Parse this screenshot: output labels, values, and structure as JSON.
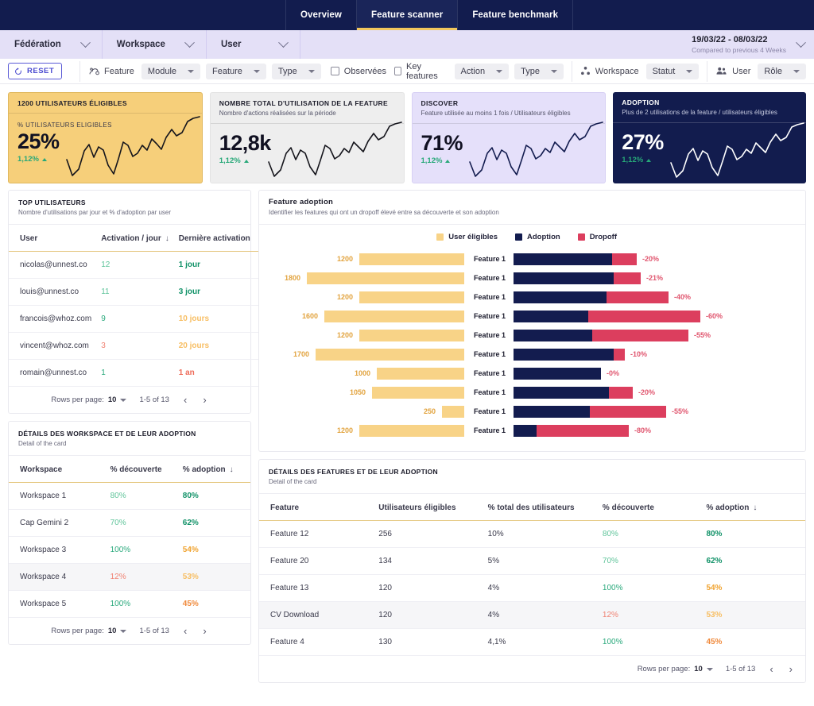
{
  "nav": {
    "tabs": [
      {
        "label": "Overview",
        "active": false
      },
      {
        "label": "Feature scanner",
        "active": true
      },
      {
        "label": "Feature benchmark",
        "active": false
      }
    ]
  },
  "filters_primary": {
    "items": [
      {
        "label": "Fédération"
      },
      {
        "label": "Workspace"
      },
      {
        "label": "User"
      }
    ],
    "date_range": "19/03/22 - 08/03/22",
    "date_compare": "Compared to previous 4 Weeks"
  },
  "filters_secondary": {
    "reset_label": "RESET",
    "feature_group_label": "Feature",
    "feature_pills": [
      "Module",
      "Feature",
      "Type"
    ],
    "checkboxes": [
      "Observées",
      "Key features"
    ],
    "action_pills": [
      "Action",
      "Type"
    ],
    "workspace_group_label": "Workspace",
    "workspace_pill": "Statut",
    "user_group_label": "User",
    "user_pill": "Rôle"
  },
  "kpis": [
    {
      "title_strong": "1200",
      "title_rest": " UTILISATEURS ÉLIGIBLES",
      "subtitle": "",
      "sublabel": "% UTILISATEURS ELIGIBLES",
      "value": "25%",
      "delta": "1,12%",
      "theme": "yellow"
    },
    {
      "title_strong": "",
      "title_rest": "NOMBRE TOTAL D'UTILISATION DE LA FEATURE",
      "subtitle": "Nombre d'actions réalisées sur la période",
      "sublabel": "",
      "value": "12,8k",
      "delta": "1,12%",
      "theme": "grey"
    },
    {
      "title_strong": "",
      "title_rest": "DISCOVER",
      "subtitle": "Feature utilisée au moins 1 fois / Utilisateurs éligibles",
      "sublabel": "",
      "value": "71%",
      "delta": "1,12%",
      "theme": "lavender"
    },
    {
      "title_strong": "",
      "title_rest": "ADOPTION",
      "subtitle": "Plus de 2 utilisations de la feature / utilisateurs éligibles",
      "sublabel": "",
      "value": "27%",
      "delta": "1,12%",
      "theme": "navy"
    }
  ],
  "top_users_card": {
    "title": "TOP UTILISATEURS",
    "subtitle": "Nombre d'utilisations par jour et % d'adoption par user",
    "columns": [
      "User",
      "Activation / jour",
      "Dernière activation"
    ],
    "sort_column": "Activation / jour",
    "rows": [
      {
        "user": "nicolas@unnest.co",
        "activation": "12",
        "activation_color": "green-l",
        "last": "1 jour",
        "last_color": "green-d"
      },
      {
        "user": "louis@unnest.co",
        "activation": "11",
        "activation_color": "green-l",
        "last": "3 jour",
        "last_color": "green-m"
      },
      {
        "user": "francois@whoz.com",
        "activation": "9",
        "activation_color": "green-m",
        "last": "10 jours",
        "last_color": "orange-l"
      },
      {
        "user": "vincent@whoz.com",
        "activation": "3",
        "activation_color": "red-l",
        "last": "20 jours",
        "last_color": "orange-l"
      },
      {
        "user": "romain@unnest.co",
        "activation": "1",
        "activation_color": "green-m",
        "last": "1 an",
        "last_color": "red"
      }
    ],
    "pager": {
      "rows_per_page_label": "Rows per page:",
      "rows_per_page_value": "10",
      "range": "1-5 of 13"
    }
  },
  "workspace_card": {
    "title": "DÉTAILS DES WORKSPACE ET DE LEUR ADOPTION",
    "subtitle": "Detail of the card",
    "columns": [
      "Workspace",
      "% découverte",
      "% adoption"
    ],
    "sort_column": "% adoption",
    "rows": [
      {
        "workspace": "Workspace 1",
        "decouverte": "80%",
        "decouverte_color": "green-l",
        "adoption": "80%",
        "adoption_color": "green-d",
        "highlight": false
      },
      {
        "workspace": "Cap Gemini 2",
        "decouverte": "70%",
        "decouverte_color": "green-l",
        "adoption": "62%",
        "adoption_color": "green-d",
        "highlight": false
      },
      {
        "workspace": "Workspace 3",
        "decouverte": "100%",
        "decouverte_color": "green-m",
        "adoption": "54%",
        "adoption_color": "orange",
        "highlight": false
      },
      {
        "workspace": "Workspace 4",
        "decouverte": "12%",
        "decouverte_color": "red-l",
        "adoption": "53%",
        "adoption_color": "orange-l",
        "highlight": true
      },
      {
        "workspace": "Workspace 5",
        "decouverte": "100%",
        "decouverte_color": "green-m",
        "adoption": "45%",
        "adoption_color": "orange-d",
        "highlight": false
      }
    ],
    "pager": {
      "rows_per_page_label": "Rows per page:",
      "rows_per_page_value": "10",
      "range": "1-5 of 13"
    }
  },
  "features_card": {
    "title": "DÉTAILS DES FEATURES ET DE LEUR ADOPTION",
    "subtitle": "Detail of the card",
    "columns": [
      "Feature",
      "Utilisateurs éligibles",
      "% total des utilisateurs",
      "% découverte",
      "% adoption"
    ],
    "sort_column": "% adoption",
    "rows": [
      {
        "feature": "Feature 12",
        "eligibles": "256",
        "pct_total": "10%",
        "decouverte": "80%",
        "decouverte_color": "green-l",
        "adoption": "80%",
        "adoption_color": "green-d",
        "highlight": false
      },
      {
        "feature": "Feature 20",
        "eligibles": "134",
        "pct_total": "5%",
        "decouverte": "70%",
        "decouverte_color": "green-l",
        "adoption": "62%",
        "adoption_color": "green-d",
        "highlight": false
      },
      {
        "feature": "Feature 13",
        "eligibles": "120",
        "pct_total": "4%",
        "decouverte": "100%",
        "decouverte_color": "green-m",
        "adoption": "54%",
        "adoption_color": "orange",
        "highlight": false
      },
      {
        "feature": "CV Download",
        "eligibles": "120",
        "pct_total": "4%",
        "decouverte": "12%",
        "decouverte_color": "red-l",
        "adoption": "53%",
        "adoption_color": "orange-l",
        "highlight": true
      },
      {
        "feature": "Feature 4",
        "eligibles": "130",
        "pct_total": "4,1%",
        "decouverte": "100%",
        "decouverte_color": "green-m",
        "adoption": "45%",
        "adoption_color": "orange-d",
        "highlight": false
      }
    ],
    "pager": {
      "rows_per_page_label": "Rows per page:",
      "rows_per_page_value": "10",
      "range": "1-5 of 13"
    }
  },
  "chart_card": {
    "title": "Feature adoption",
    "subtitle": "Identifier les features qui ont un dropoff élevé entre sa découverte et son adoption"
  },
  "chart_data": {
    "type": "bar",
    "title": "Feature adoption",
    "subtitle": "Identifier les features qui ont un dropoff élevé entre sa découverte et son adoption",
    "orientation": "horizontal",
    "legend": [
      {
        "name": "User éligibles",
        "color": "#F8D387"
      },
      {
        "name": "Adoption",
        "color": "#131C4F"
      },
      {
        "name": "Dropoff",
        "color": "#DC3E5E"
      }
    ],
    "legend_position": "top",
    "grid": false,
    "categories": [
      "Feature 1",
      "Feature 1",
      "Feature 1",
      "Feature 1",
      "Feature 1",
      "Feature 1",
      "Feature 1",
      "Feature 1",
      "Feature 1",
      "Feature 1"
    ],
    "series": [
      {
        "name": "User éligibles",
        "values": [
          1200,
          1800,
          1200,
          1600,
          1200,
          1700,
          1000,
          1050,
          250,
          1200
        ],
        "labels": [
          "1200",
          "1800",
          "1200",
          "1600",
          "1200",
          "1700",
          "1000",
          "1050",
          "250",
          "1200"
        ],
        "max": 1800,
        "align": "right"
      },
      {
        "name": "Adoption",
        "values": [
          80,
          79,
          60,
          40,
          45,
          90,
          100,
          80,
          55,
          20
        ]
      },
      {
        "name": "Dropoff",
        "values": [
          20,
          21,
          40,
          60,
          55,
          10,
          0,
          20,
          55,
          80
        ],
        "labels": [
          "-20%",
          "-21%",
          "-40%",
          "-60%",
          "-55%",
          "-10%",
          "-0%",
          "-20%",
          "-55%",
          "-80%"
        ]
      }
    ],
    "stacked_total_widths": [
      155,
      160,
      195,
      235,
      220,
      140,
      110,
      150,
      175,
      145
    ]
  },
  "colors": {
    "navy": "#121C4E",
    "gold": "#F2C75C",
    "lavender": "#E4E0F7",
    "red": "#DC3E5E",
    "yellow": "#F8D387",
    "accent_purple": "#4b4bd0"
  }
}
